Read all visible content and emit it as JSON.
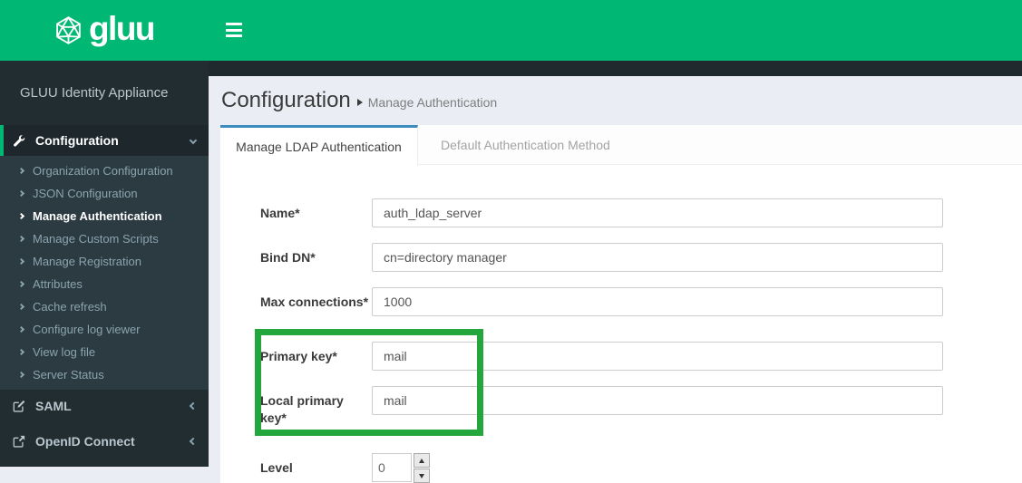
{
  "colors": {
    "brand_green": "#00b873",
    "annotation_green": "#23a63c",
    "sidebar_bg": "#222d32",
    "submenu_bg": "#2c3b41",
    "active_item_bg": "#1e282c",
    "content_bg": "#eaeef4",
    "tab_accent_blue": "#3c8dbc"
  },
  "navbar": {
    "brand": "gluu"
  },
  "sidebar": {
    "title": "GLUU Identity Appliance",
    "sections": [
      {
        "label": "Configuration",
        "icon": "wrench-icon",
        "state": "expanded",
        "active": true,
        "children": [
          "Organization Configuration",
          "JSON Configuration",
          "Manage Authentication",
          "Manage Custom Scripts",
          "Manage Registration",
          "Attributes",
          "Cache refresh",
          "Configure log viewer",
          "View log file",
          "Server Status"
        ],
        "active_child": "Manage Authentication"
      },
      {
        "label": "SAML",
        "icon": "edit-icon",
        "state": "collapsed"
      },
      {
        "label": "OpenID Connect",
        "icon": "external-link-icon",
        "state": "collapsed"
      }
    ]
  },
  "breadcrumb": {
    "title": "Configuration",
    "section": "Manage Authentication"
  },
  "tabs": [
    {
      "label": "Manage LDAP Authentication",
      "active": true
    },
    {
      "label": "Default Authentication Method",
      "active": false
    }
  ],
  "form": {
    "fields": [
      {
        "label": "Name*",
        "value": "auth_ldap_server",
        "type": "text"
      },
      {
        "label": "Bind DN*",
        "value": "cn=directory manager",
        "type": "text"
      },
      {
        "label": "Max connections*",
        "value": "1000",
        "type": "text"
      },
      {
        "label": "Primary key*",
        "value": "mail",
        "type": "text",
        "highlighted": true
      },
      {
        "label": "Local primary key*",
        "value": "mail",
        "type": "text",
        "highlighted": true
      },
      {
        "label": "Level",
        "value": "0",
        "type": "spinner"
      }
    ]
  },
  "annotation": {
    "shape": "rectangle",
    "color": "#23a63c",
    "purpose": "highlights Primary key and Local primary key fields"
  }
}
